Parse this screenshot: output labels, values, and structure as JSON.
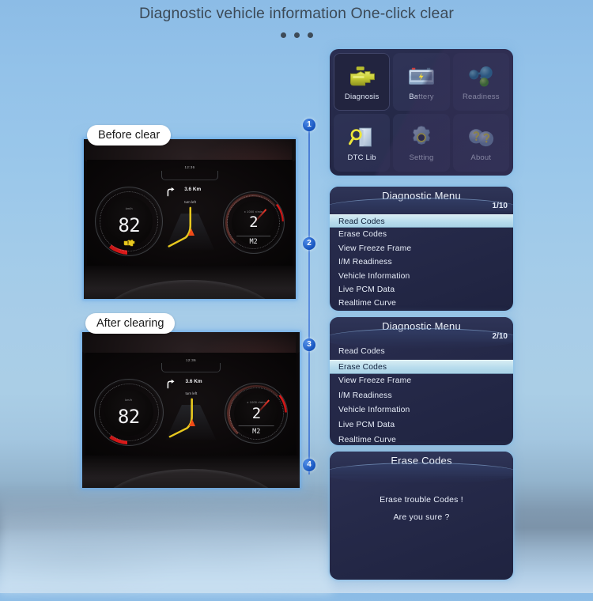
{
  "header": {
    "title": "Diagnostic vehicle information One-click clear",
    "dots_count": 3
  },
  "comparison": {
    "before": {
      "caption": "Before clear",
      "speed_value": "82",
      "speed_unit": "km/h",
      "rpm_value": "2",
      "rpm_unit": "x 1000 r/min",
      "gear": "M2",
      "nav_distance": "3.6 Km",
      "nav_instruction": "turn left",
      "clock": "12:36",
      "mil_warning_on": true,
      "mil_icon_name": "check-engine-light"
    },
    "after": {
      "caption": "After clearing",
      "speed_value": "82",
      "speed_unit": "km/h",
      "rpm_value": "2",
      "rpm_unit": "x 1000 r/min",
      "gear": "M2",
      "nav_distance": "3.6 Km",
      "nav_instruction": "turn left",
      "clock": "12:36",
      "mil_warning_on": false,
      "mil_icon_name": "check-engine-light"
    }
  },
  "timeline": {
    "steps": [
      {
        "number": "1"
      },
      {
        "number": "2"
      },
      {
        "number": "3"
      },
      {
        "number": "4"
      }
    ],
    "rail_color": "#3a6fd0",
    "badge_color": "#1452bd"
  },
  "step1_home": {
    "tiles": [
      {
        "label": "Diagnosis",
        "icon": "engine-icon",
        "selected": true
      },
      {
        "label": "Battery",
        "icon": "battery-icon",
        "selected": false
      },
      {
        "label": "Readiness",
        "icon": "molecule-icon",
        "selected": false
      },
      {
        "label": "DTC Lib",
        "icon": "magnifier-book-icon",
        "selected": false
      },
      {
        "label": "Setting",
        "icon": "gear-icon",
        "selected": false
      },
      {
        "label": "About",
        "icon": "question-marks-icon",
        "selected": false
      }
    ]
  },
  "step2_menu": {
    "title": "Diagnostic Menu",
    "page": "1/10",
    "items": [
      {
        "label": "Read Codes",
        "active": true
      },
      {
        "label": "Erase Codes",
        "active": false
      },
      {
        "label": "View Freeze Frame",
        "active": false
      },
      {
        "label": "I/M Readiness",
        "active": false
      },
      {
        "label": "Vehicle Information",
        "active": false
      },
      {
        "label": "Live PCM Data",
        "active": false
      },
      {
        "label": "Realtime Curve",
        "active": false
      }
    ]
  },
  "step3_menu": {
    "title": "Diagnostic Menu",
    "page": "2/10",
    "items": [
      {
        "label": "Read Codes",
        "active": false
      },
      {
        "label": "Erase Codes",
        "active": true
      },
      {
        "label": "View Freeze Frame",
        "active": false
      },
      {
        "label": "I/M Readiness",
        "active": false
      },
      {
        "label": "Vehicle Information",
        "active": false
      },
      {
        "label": "Live PCM Data",
        "active": false
      },
      {
        "label": "Realtime Curve",
        "active": false
      }
    ]
  },
  "step4_dialog": {
    "title": "Erase Codes",
    "line1": "Erase trouble Codes !",
    "line2": "Are you sure ?"
  },
  "colors": {
    "background_top": "#8cbce6",
    "accent_blue": "#1452bd",
    "menu_bg": "#262a4a",
    "highlight": "#b8dced",
    "warning_yellow": "#e8c820",
    "gauge_red": "#e01b1b"
  }
}
